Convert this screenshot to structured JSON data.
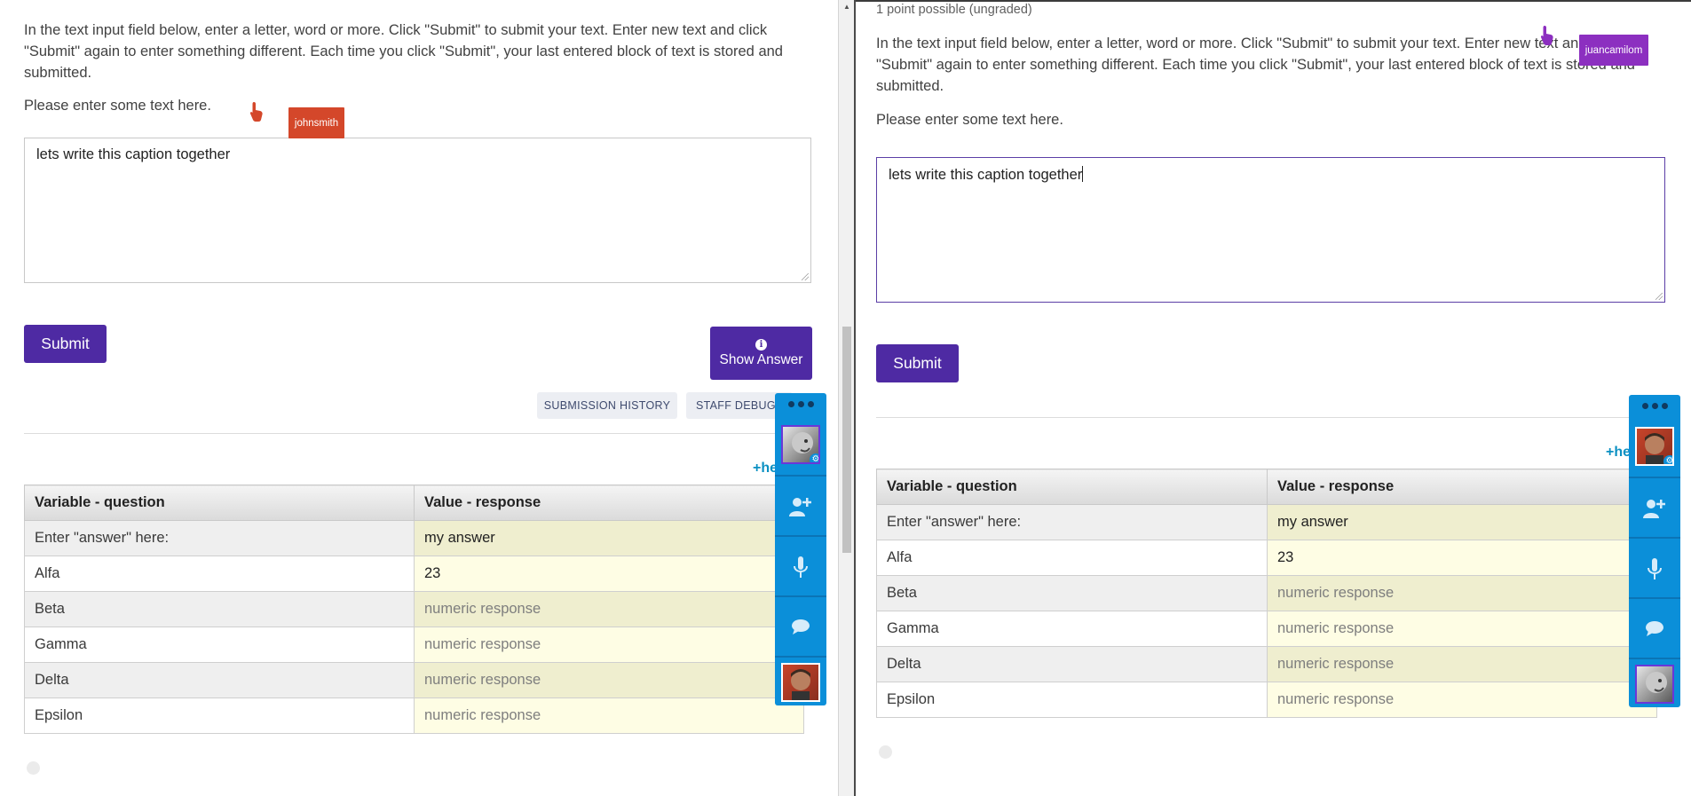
{
  "problem": {
    "points_text": "1 point possible (ungraded)",
    "instructions": "In the text input field below, enter a letter, word or more. Click \"Submit\" to submit your text. Enter new text and click \"Submit\" again to enter something different. Each time you click \"Submit\", your last entered block of text is stored and submitted.",
    "prompt": "Please enter some text here.",
    "textarea_value": "lets write this caption together",
    "submit_label": "Submit",
    "show_answer_label": "Show Answer",
    "info_icon_glyph": "i",
    "submission_history_label": "SUBMISSION HISTORY",
    "staff_debug_label": "STAFF DEBUG",
    "help_link_left": "+he",
    "help_link_right": "+he"
  },
  "table": {
    "headers": [
      "Variable - question",
      "Value - response"
    ],
    "rows": [
      {
        "variable": "Enter \"answer\" here:",
        "value": "my answer"
      },
      {
        "variable": "Alfa",
        "value": "23"
      },
      {
        "variable": "Beta",
        "value": "numeric response"
      },
      {
        "variable": "Gamma",
        "value": "numeric response"
      },
      {
        "variable": "Delta",
        "value": "numeric response"
      },
      {
        "variable": "Epsilon",
        "value": "numeric response"
      }
    ]
  },
  "collaborators": {
    "left_cursor_user": "johnsmith",
    "right_cursor_user": "juancamilom",
    "left_cursor_color": "#d4472a",
    "right_cursor_color": "#8c2fc0"
  },
  "side_panel": {
    "menu_icon": "more-dots-icon",
    "buttons": [
      "add-person-icon",
      "microphone-icon",
      "chat-bubble-icon"
    ],
    "accent": "#0b8fd9"
  },
  "colors": {
    "primary_button": "#4e2aa3",
    "link": "#0b90c2"
  }
}
